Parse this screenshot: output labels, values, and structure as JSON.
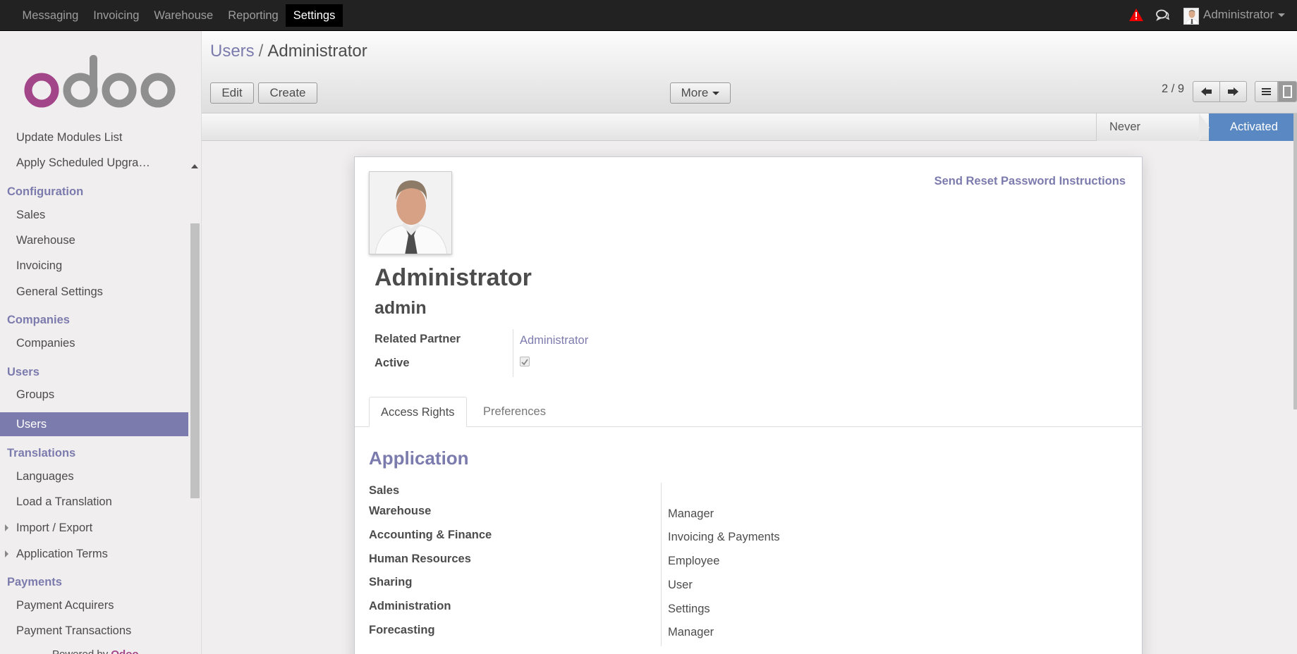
{
  "topnav": {
    "items": [
      "Messaging",
      "Invoicing",
      "Warehouse",
      "Reporting",
      "Settings"
    ],
    "user": "Administrator"
  },
  "sidebar": {
    "items": {
      "update_modules": "Update Modules List",
      "apply_upgrades": "Apply Scheduled Upgra…",
      "configuration": "Configuration",
      "sales": "Sales",
      "warehouse": "Warehouse",
      "invoicing": "Invoicing",
      "general_settings": "General Settings",
      "companies_head": "Companies",
      "companies": "Companies",
      "users_head": "Users",
      "groups": "Groups",
      "users": "Users",
      "translations": "Translations",
      "languages": "Languages",
      "load_translation": "Load a Translation",
      "import_export": "Import / Export",
      "application_terms": "Application Terms",
      "payments": "Payments",
      "payment_acquirers": "Payment Acquirers",
      "payment_transactions": "Payment Transactions"
    },
    "powered_by": "Powered by",
    "powered_brand": "Odoo"
  },
  "control_panel": {
    "breadcrumb_parent": "Users",
    "breadcrumb_sep": "/",
    "breadcrumb_current": "Administrator",
    "edit": "Edit",
    "create": "Create",
    "more": "More",
    "pager": "2 / 9"
  },
  "statusbar": {
    "never_connected": "Never Connected",
    "activated": "Activated"
  },
  "form": {
    "reset_password": "Send Reset Password Instructions",
    "name": "Administrator",
    "login": "admin",
    "related_partner_label": "Related Partner",
    "related_partner_value": "Administrator",
    "active_label": "Active",
    "active": true,
    "tabs": [
      "Access Rights",
      "Preferences"
    ],
    "section_title": "Application",
    "rights": [
      {
        "label": "Sales",
        "value": ""
      },
      {
        "label": "Warehouse",
        "value": "Manager"
      },
      {
        "label": "Accounting & Finance",
        "value": "Invoicing & Payments"
      },
      {
        "label": "Human Resources",
        "value": "Employee"
      },
      {
        "label": "Sharing",
        "value": "User"
      },
      {
        "label": "Administration",
        "value": "Settings"
      },
      {
        "label": "Forecasting",
        "value": "Manager"
      }
    ]
  },
  "colors": {
    "accent": "#7c7bad",
    "odoo_brand": "#a24689",
    "status_active": "#5a88c2",
    "topbar": "#222222"
  }
}
